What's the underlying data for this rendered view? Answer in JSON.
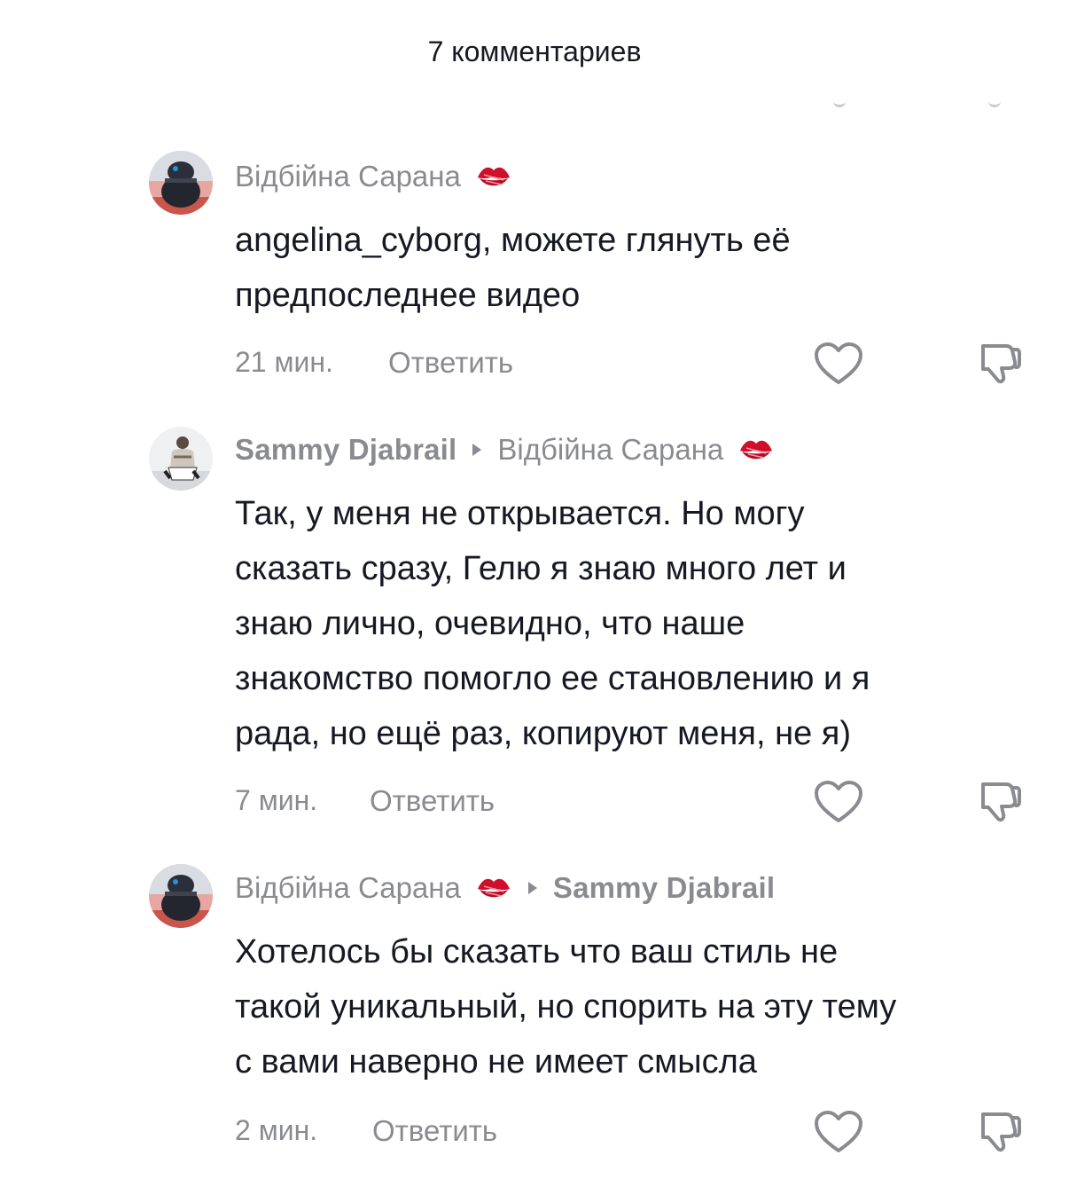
{
  "header": {
    "title": "7 комментариев"
  },
  "comments": [
    {
      "author": "Відбійна Сарана",
      "author_emoji": "kiss-mark-icon",
      "reply_to": "",
      "text_lines": [
        "angelina_cyborg, можете глянуть её",
        "предпоследнее видео"
      ],
      "time": "21 мин.",
      "reply_label": "Ответить"
    },
    {
      "author": "Sammy Djabrail",
      "reply_to": "Відбійна Сарана",
      "reply_to_emoji": "kiss-mark-icon",
      "text_lines": [
        "Так, у меня не открывается. Но могу",
        "сказать сразу, Гелю я знаю много лет и",
        "знаю лично, очевидно, что наше",
        "знакомство помогло ее становлению и я",
        "рада, но ещё раз, копируют меня, не я)"
      ],
      "time": "7 мин.",
      "reply_label": "Ответить"
    },
    {
      "author": "Відбійна Сарана",
      "author_emoji": "kiss-mark-icon",
      "reply_to": "Sammy Djabrail",
      "text_lines": [
        "Хотелось бы сказать что ваш стиль не",
        "такой уникальный, но спорить на эту тему",
        "с вами наверно не имеет смысла"
      ],
      "time": "2 мин.",
      "reply_label": "Ответить"
    }
  ],
  "colors": {
    "primary_text": "#161823",
    "secondary_text": "#8a8b91",
    "kiss_red": "#d0102a"
  }
}
